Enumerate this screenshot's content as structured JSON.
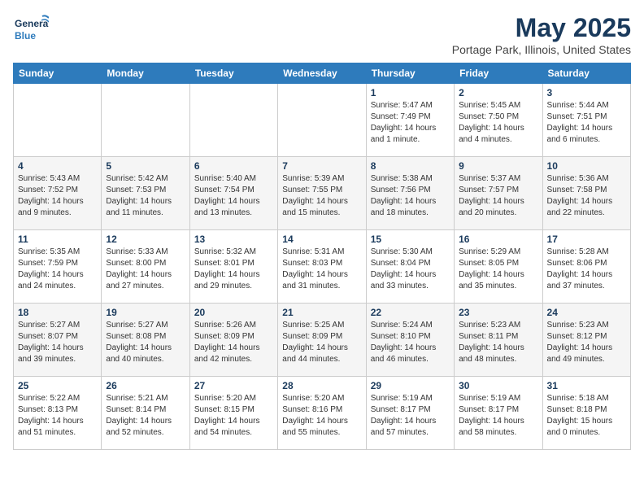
{
  "logo": {
    "line1": "General",
    "line2": "Blue"
  },
  "title": "May 2025",
  "subtitle": "Portage Park, Illinois, United States",
  "days_of_week": [
    "Sunday",
    "Monday",
    "Tuesday",
    "Wednesday",
    "Thursday",
    "Friday",
    "Saturday"
  ],
  "weeks": [
    [
      {
        "day": "",
        "info": ""
      },
      {
        "day": "",
        "info": ""
      },
      {
        "day": "",
        "info": ""
      },
      {
        "day": "",
        "info": ""
      },
      {
        "day": "1",
        "info": "Sunrise: 5:47 AM\nSunset: 7:49 PM\nDaylight: 14 hours\nand 1 minute."
      },
      {
        "day": "2",
        "info": "Sunrise: 5:45 AM\nSunset: 7:50 PM\nDaylight: 14 hours\nand 4 minutes."
      },
      {
        "day": "3",
        "info": "Sunrise: 5:44 AM\nSunset: 7:51 PM\nDaylight: 14 hours\nand 6 minutes."
      }
    ],
    [
      {
        "day": "4",
        "info": "Sunrise: 5:43 AM\nSunset: 7:52 PM\nDaylight: 14 hours\nand 9 minutes."
      },
      {
        "day": "5",
        "info": "Sunrise: 5:42 AM\nSunset: 7:53 PM\nDaylight: 14 hours\nand 11 minutes."
      },
      {
        "day": "6",
        "info": "Sunrise: 5:40 AM\nSunset: 7:54 PM\nDaylight: 14 hours\nand 13 minutes."
      },
      {
        "day": "7",
        "info": "Sunrise: 5:39 AM\nSunset: 7:55 PM\nDaylight: 14 hours\nand 15 minutes."
      },
      {
        "day": "8",
        "info": "Sunrise: 5:38 AM\nSunset: 7:56 PM\nDaylight: 14 hours\nand 18 minutes."
      },
      {
        "day": "9",
        "info": "Sunrise: 5:37 AM\nSunset: 7:57 PM\nDaylight: 14 hours\nand 20 minutes."
      },
      {
        "day": "10",
        "info": "Sunrise: 5:36 AM\nSunset: 7:58 PM\nDaylight: 14 hours\nand 22 minutes."
      }
    ],
    [
      {
        "day": "11",
        "info": "Sunrise: 5:35 AM\nSunset: 7:59 PM\nDaylight: 14 hours\nand 24 minutes."
      },
      {
        "day": "12",
        "info": "Sunrise: 5:33 AM\nSunset: 8:00 PM\nDaylight: 14 hours\nand 27 minutes."
      },
      {
        "day": "13",
        "info": "Sunrise: 5:32 AM\nSunset: 8:01 PM\nDaylight: 14 hours\nand 29 minutes."
      },
      {
        "day": "14",
        "info": "Sunrise: 5:31 AM\nSunset: 8:03 PM\nDaylight: 14 hours\nand 31 minutes."
      },
      {
        "day": "15",
        "info": "Sunrise: 5:30 AM\nSunset: 8:04 PM\nDaylight: 14 hours\nand 33 minutes."
      },
      {
        "day": "16",
        "info": "Sunrise: 5:29 AM\nSunset: 8:05 PM\nDaylight: 14 hours\nand 35 minutes."
      },
      {
        "day": "17",
        "info": "Sunrise: 5:28 AM\nSunset: 8:06 PM\nDaylight: 14 hours\nand 37 minutes."
      }
    ],
    [
      {
        "day": "18",
        "info": "Sunrise: 5:27 AM\nSunset: 8:07 PM\nDaylight: 14 hours\nand 39 minutes."
      },
      {
        "day": "19",
        "info": "Sunrise: 5:27 AM\nSunset: 8:08 PM\nDaylight: 14 hours\nand 40 minutes."
      },
      {
        "day": "20",
        "info": "Sunrise: 5:26 AM\nSunset: 8:09 PM\nDaylight: 14 hours\nand 42 minutes."
      },
      {
        "day": "21",
        "info": "Sunrise: 5:25 AM\nSunset: 8:09 PM\nDaylight: 14 hours\nand 44 minutes."
      },
      {
        "day": "22",
        "info": "Sunrise: 5:24 AM\nSunset: 8:10 PM\nDaylight: 14 hours\nand 46 minutes."
      },
      {
        "day": "23",
        "info": "Sunrise: 5:23 AM\nSunset: 8:11 PM\nDaylight: 14 hours\nand 48 minutes."
      },
      {
        "day": "24",
        "info": "Sunrise: 5:23 AM\nSunset: 8:12 PM\nDaylight: 14 hours\nand 49 minutes."
      }
    ],
    [
      {
        "day": "25",
        "info": "Sunrise: 5:22 AM\nSunset: 8:13 PM\nDaylight: 14 hours\nand 51 minutes."
      },
      {
        "day": "26",
        "info": "Sunrise: 5:21 AM\nSunset: 8:14 PM\nDaylight: 14 hours\nand 52 minutes."
      },
      {
        "day": "27",
        "info": "Sunrise: 5:20 AM\nSunset: 8:15 PM\nDaylight: 14 hours\nand 54 minutes."
      },
      {
        "day": "28",
        "info": "Sunrise: 5:20 AM\nSunset: 8:16 PM\nDaylight: 14 hours\nand 55 minutes."
      },
      {
        "day": "29",
        "info": "Sunrise: 5:19 AM\nSunset: 8:17 PM\nDaylight: 14 hours\nand 57 minutes."
      },
      {
        "day": "30",
        "info": "Sunrise: 5:19 AM\nSunset: 8:17 PM\nDaylight: 14 hours\nand 58 minutes."
      },
      {
        "day": "31",
        "info": "Sunrise: 5:18 AM\nSunset: 8:18 PM\nDaylight: 15 hours\nand 0 minutes."
      }
    ]
  ]
}
